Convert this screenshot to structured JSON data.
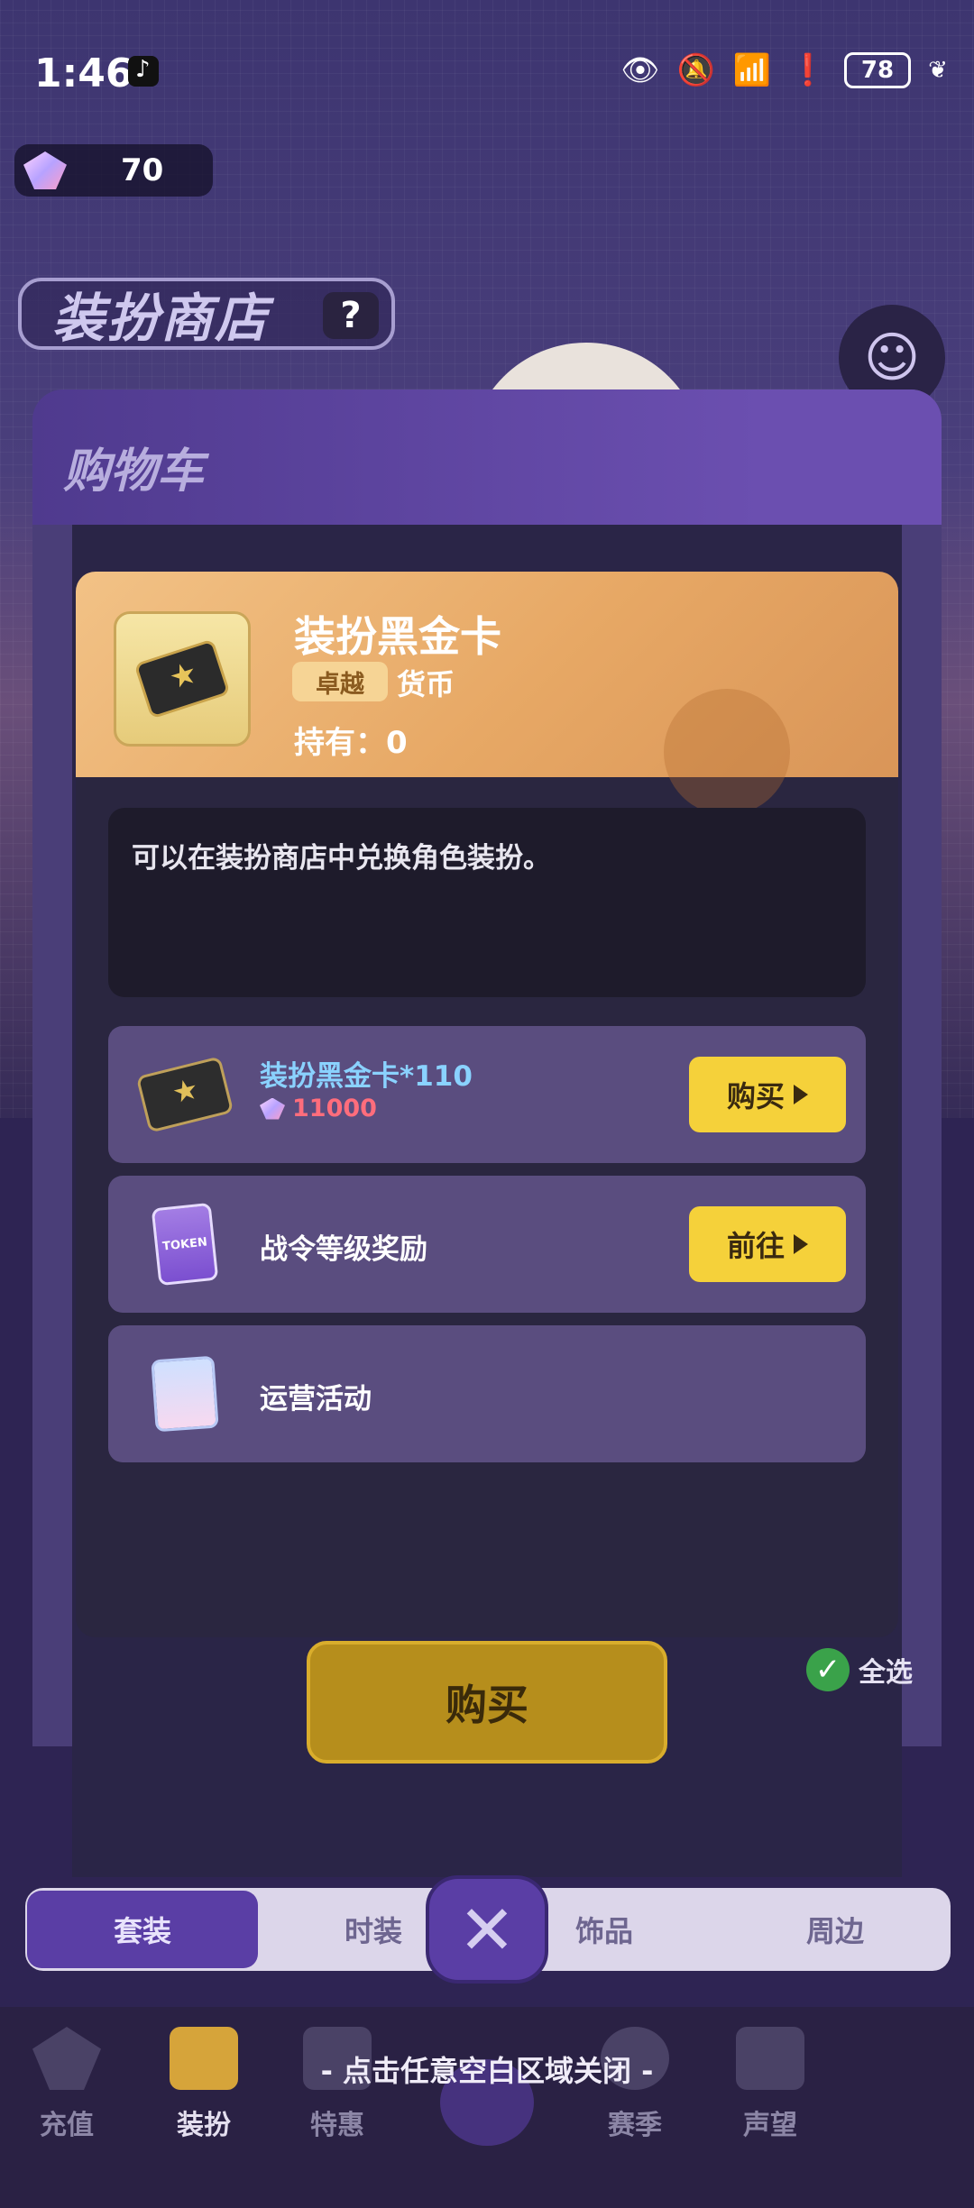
{
  "status_bar": {
    "time": "1:46",
    "battery": "78",
    "icons": [
      "tiktok-icon",
      "eye-icon",
      "bell-off-icon",
      "wifi-icon",
      "alert-icon",
      "battery-icon",
      "leaf-icon"
    ]
  },
  "currency": {
    "gems": "70"
  },
  "shop": {
    "title": "装扮商店",
    "help": "?"
  },
  "cart": {
    "title": "购物车",
    "buy_label": "购买",
    "select_all_label": "全选"
  },
  "category_tabs": [
    "套装",
    "时装",
    "饰品",
    "周边"
  ],
  "bottom_nav": {
    "items": [
      "充值",
      "装扮",
      "特惠",
      "赛季",
      "声望"
    ],
    "active": "装扮",
    "close_hint": "- 点击任意空白区域关闭 -"
  },
  "item_modal": {
    "name": "装扮黑金卡",
    "rarity": "卓越",
    "type": "货币",
    "owned": "持有：0",
    "description": "可以在装扮商店中兑换角色装扮。",
    "sources": [
      {
        "title": "装扮黑金卡*110",
        "price": "11000",
        "button": "购买",
        "icon": "black-gold-card-icon"
      },
      {
        "title": "战令等级奖励",
        "button": "前往",
        "icon": "token-card-icon"
      },
      {
        "title": "运营活动",
        "icon": "event-card-icon"
      }
    ]
  },
  "colors": {
    "accent_yellow": "#f5d13a",
    "header_orange": "#e7a865",
    "purple_primary": "#5a3ea5",
    "price_red": "#ff6d7c",
    "title_blue": "#8ad2ff"
  }
}
